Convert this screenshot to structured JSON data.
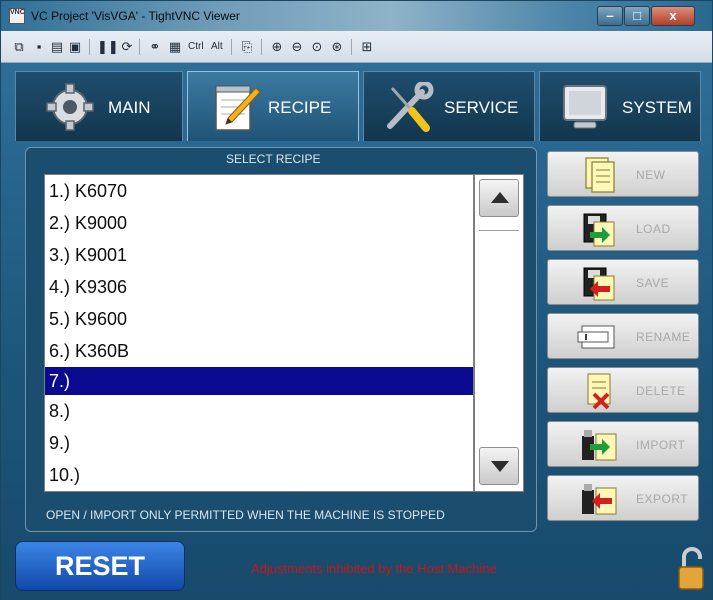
{
  "window": {
    "title": "VC Project 'VisVGA' - TightVNC Viewer",
    "app_icon": "vnc-app-icon",
    "controls": {
      "minimize": "–",
      "maximize": "□",
      "close": "x"
    }
  },
  "toolbar": {
    "icons": [
      "new-connection-icon",
      "save-icon",
      "options-icon",
      "info-icon",
      "pause-icon",
      "refresh-icon",
      "send-ctrl-alt-del-icon",
      "send-ctrl-esc-icon",
      "copy-icon",
      "zoom-in-icon",
      "zoom-out-icon",
      "zoom-100-icon",
      "zoom-auto-icon",
      "fullscreen-icon"
    ],
    "ctrl_label": "Ctrl",
    "alt_label": "Alt"
  },
  "tabs": [
    {
      "label": "MAIN",
      "icon": "gear-icon",
      "active": false
    },
    {
      "label": "RECIPE",
      "icon": "notepad-pencil-icon",
      "active": true
    },
    {
      "label": "SERVICE",
      "icon": "wrench-screwdriver-icon",
      "active": false
    },
    {
      "label": "SYSTEM",
      "icon": "monitor-icon",
      "active": false
    }
  ],
  "recipe_panel": {
    "title": "SELECT RECIPE",
    "items": [
      "1.) K6070",
      "2.) K9000",
      "3.) K9001",
      "4.) K9306",
      "5.) K9600",
      "6.) K360B",
      "7.)",
      "8.)",
      "9.)",
      "10.)"
    ],
    "selected_index": 6,
    "note": "OPEN / IMPORT ONLY PERMITTED WHEN THE MACHINE IS STOPPED"
  },
  "actions": [
    {
      "label": "NEW",
      "icon": "new-document-icon"
    },
    {
      "label": "LOAD",
      "icon": "load-disk-icon"
    },
    {
      "label": "SAVE",
      "icon": "save-disk-icon"
    },
    {
      "label": "RENAME",
      "icon": "rename-icon"
    },
    {
      "label": "DELETE",
      "icon": "delete-document-icon"
    },
    {
      "label": "IMPORT",
      "icon": "import-usb-icon"
    },
    {
      "label": "EXPORT",
      "icon": "export-usb-icon"
    }
  ],
  "bottom": {
    "reset_label": "RESET",
    "warning": "Adjustments inhibited by the Host Machine",
    "lock_icon": "unlocked-padlock-icon"
  },
  "colors": {
    "selection": "#0a0a90",
    "warning_text": "#c9161a",
    "reset_button": "#1f5fc9",
    "background": "#1c5478"
  }
}
